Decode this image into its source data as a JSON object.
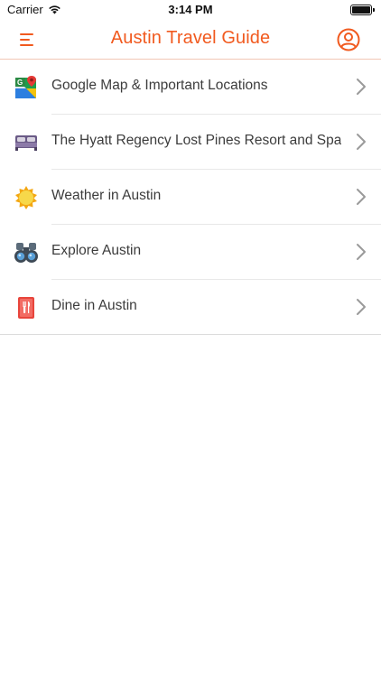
{
  "status_bar": {
    "carrier": "Carrier",
    "time": "3:14 PM"
  },
  "nav": {
    "title": "Austin Travel Guide",
    "accent_color": "#f15a1f",
    "left_icon": "menu-icon",
    "right_icon": "profile-icon"
  },
  "list": {
    "items": [
      {
        "label": "Google Map & Important Locations",
        "icon": "google-maps-icon"
      },
      {
        "label": "The Hyatt Regency Lost Pines Resort and Spa",
        "icon": "bed-icon"
      },
      {
        "label": "Weather in Austin",
        "icon": "sun-icon"
      },
      {
        "label": "Explore Austin",
        "icon": "binoculars-icon"
      },
      {
        "label": "Dine in Austin",
        "icon": "restaurant-menu-icon"
      }
    ]
  }
}
